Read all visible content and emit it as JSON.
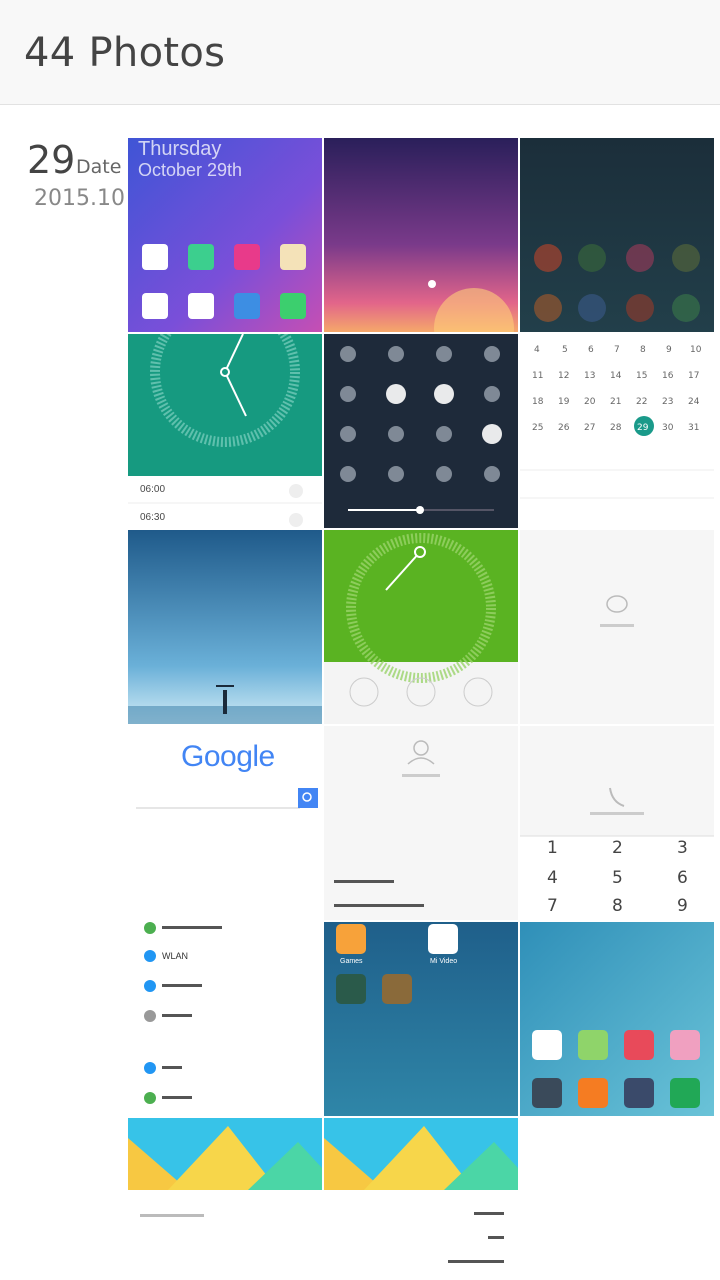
{
  "header": {
    "title": "44 Photos"
  },
  "date_group": {
    "day": "29",
    "day_label": "Date",
    "year_month": "2015.10"
  },
  "photos": [
    {
      "id": "home-screen",
      "texts": [
        "Thursday",
        "October 29th"
      ]
    },
    {
      "id": "lock-screen",
      "texts": []
    },
    {
      "id": "blurred-dark",
      "texts": []
    },
    {
      "id": "clock-alarm",
      "texts": [
        "06:00",
        "06:30"
      ]
    },
    {
      "id": "control-center",
      "texts": []
    },
    {
      "id": "calendar",
      "texts": []
    },
    {
      "id": "starry-sky",
      "texts": []
    },
    {
      "id": "cleaner-green",
      "texts": []
    },
    {
      "id": "messages-empty",
      "texts": []
    },
    {
      "id": "google-search",
      "texts": [
        "Google"
      ]
    },
    {
      "id": "contacts-empty",
      "texts": []
    },
    {
      "id": "dialer",
      "texts": [
        "1",
        "2",
        "3",
        "4",
        "5",
        "6",
        "7",
        "8",
        "9"
      ]
    },
    {
      "id": "settings-list",
      "texts": [
        "WLAN"
      ]
    },
    {
      "id": "folder-screen",
      "texts": [
        "Games",
        "Mi Video"
      ]
    },
    {
      "id": "home-screen-2",
      "texts": []
    },
    {
      "id": "theme-yellow-1",
      "texts": []
    },
    {
      "id": "theme-yellow-2",
      "texts": []
    }
  ]
}
